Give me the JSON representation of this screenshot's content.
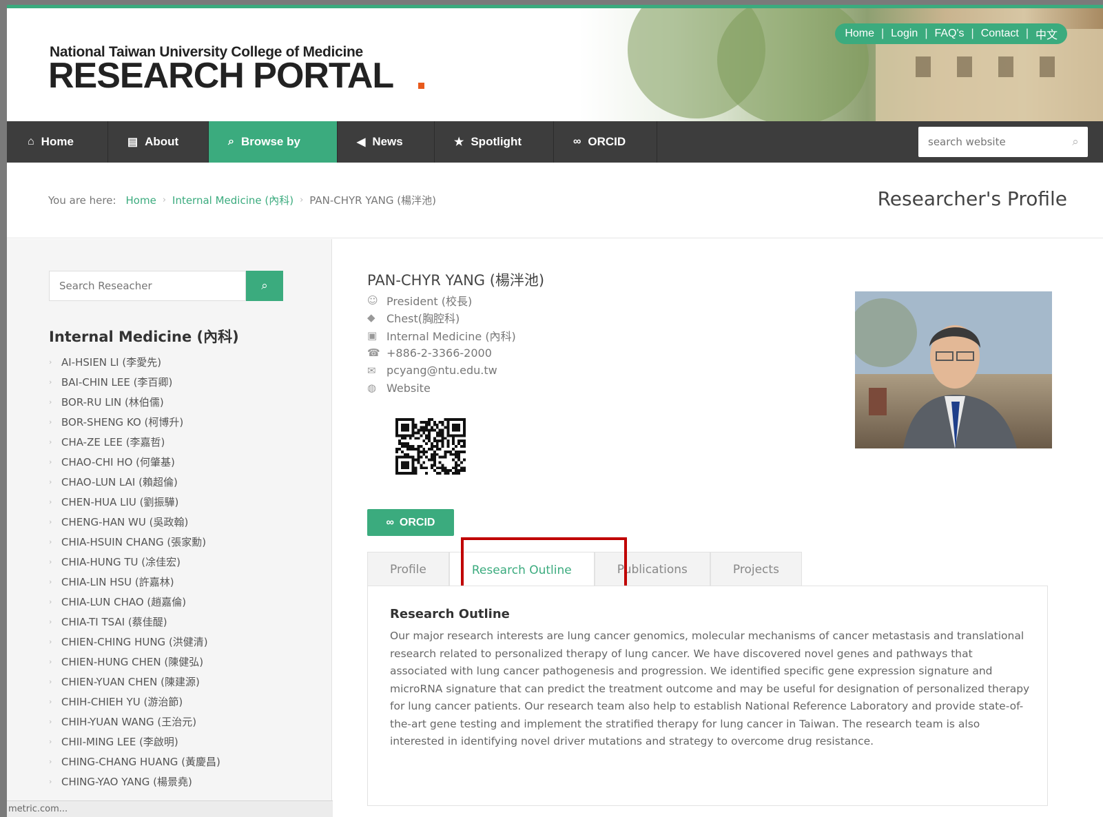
{
  "header": {
    "university": "National Taiwan University College of Medicine",
    "portal": "RESEARCH PORTAL",
    "top_links": [
      "Home",
      "Login",
      "FAQ's",
      "Contact",
      "中文"
    ]
  },
  "nav": {
    "items": [
      {
        "label": "Home",
        "icon": "home-icon"
      },
      {
        "label": "About",
        "icon": "file-icon"
      },
      {
        "label": "Browse by",
        "icon": "search-icon"
      },
      {
        "label": "News",
        "icon": "megaphone-icon"
      },
      {
        "label": "Spotlight",
        "icon": "star-icon"
      },
      {
        "label": "ORCID",
        "icon": "link-icon"
      }
    ],
    "active": "Browse by",
    "search_placeholder": "search website"
  },
  "breadcrumb": {
    "label": "You are here:",
    "items": [
      "Home",
      "Internal Medicine (內科)",
      "PAN-CHYR YANG (楊泮池)"
    ]
  },
  "page_title": "Researcher's Profile",
  "sidebar": {
    "search_placeholder": "Search Reseacher",
    "department": "Internal Medicine (內科)",
    "researchers": [
      "AI-HSIEN LI (李愛先)",
      "BAI-CHIN LEE (李百卿)",
      "BOR-RU LIN (林伯儒)",
      "BOR-SHENG KO (柯博升)",
      "CHA-ZE LEE (李嘉哲)",
      "CHAO-CHI HO (何肇基)",
      "CHAO-LUN LAI (賴超倫)",
      "CHEN-HUA LIU (劉振驊)",
      "CHENG-HAN WU (吳政翰)",
      "CHIA-HSUIN CHANG (張家勳)",
      "CHIA-HUNG TU (凃佳宏)",
      "CHIA-LIN HSU (許嘉林)",
      "CHIA-LUN CHAO (趙嘉倫)",
      "CHIA-TI TSAI (蔡佳醍)",
      "CHIEN-CHING HUNG (洪健清)",
      "CHIEN-HUNG CHEN (陳健弘)",
      "CHIEN-YUAN CHEN (陳建源)",
      "CHIH-CHIEH YU (游治節)",
      "CHIH-YUAN WANG (王治元)",
      "CHII-MING LEE (李啟明)",
      "CHING-CHANG HUANG (黃慶昌)",
      "CHING-YAO YANG (楊景堯)"
    ],
    "status_text": "metric.com..."
  },
  "profile": {
    "name": "PAN-CHYR YANG (楊泮池)",
    "info": [
      {
        "icon": "user-icon",
        "text": "President (校長)"
      },
      {
        "icon": "tags-icon",
        "text": "Chest(胸腔科)"
      },
      {
        "icon": "building-icon",
        "text": "Internal Medicine (內科)"
      },
      {
        "icon": "phone-icon",
        "text": "+886-2-3366-2000"
      },
      {
        "icon": "envelope-icon",
        "text": "pcyang@ntu.edu.tw"
      },
      {
        "icon": "globe-icon",
        "text": "Website"
      }
    ],
    "orcid_label": "ORCID"
  },
  "tabs": {
    "items": [
      "Profile",
      "Research Outline",
      "Publications",
      "Projects"
    ],
    "active": "Research Outline"
  },
  "panel": {
    "title": "Research Outline",
    "text": "Our major research interests are lung cancer genomics, molecular mechanisms of cancer metastasis and translational research related to personalized therapy of lung cancer. We have discovered novel genes and pathways that associated with lung cancer pathogenesis and progression. We identified specific gene expression signature and microRNA signature that can predict the treatment outcome and may be useful for designation of personalized therapy for lung cancer patients. Our research team also help to establish National Reference Laboratory and provide state-of-the-art gene testing and implement the stratified therapy for lung cancer in Taiwan. The research team is also interested in identifying novel driver mutations and strategy to overcome drug resistance."
  },
  "colors": {
    "accent": "#3bab7e",
    "nav_bg": "#3d3d3d",
    "highlight_box": "#c00000"
  }
}
